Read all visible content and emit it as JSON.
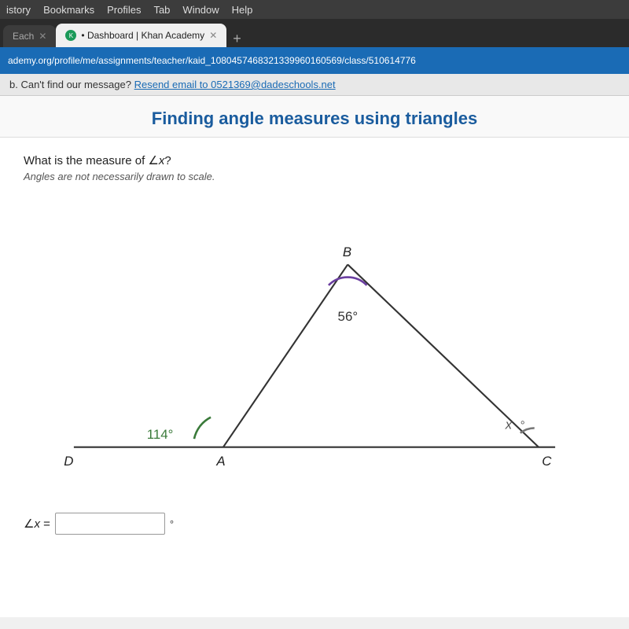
{
  "menu_bar": {
    "items": [
      "istory",
      "Bookmarks",
      "Profiles",
      "Tab",
      "Window",
      "Help"
    ]
  },
  "tabs": [
    {
      "label": "Each",
      "active": false,
      "has_favicon": false,
      "id": "tab-each"
    },
    {
      "label": "Dashboard | Khan Academy",
      "active": true,
      "has_favicon": true,
      "id": "tab-khan"
    }
  ],
  "url_bar": {
    "text": "ademy.org/profile/me/assignments/teacher/kaid_1080457468321339960160569/class/510614776"
  },
  "notification_bar": {
    "prefix_text": "b. Can't find our message?",
    "link_text": "Resend email to 0521369@dadeschools.net",
    "link_href": "mailto:0521369@dadeschools.net"
  },
  "page_title": "Finding angle measures using triangles",
  "question": {
    "main_text": "What is the measure of ∠x?",
    "note_text": "Angles are not necessarily drawn to scale."
  },
  "diagram": {
    "vertices": {
      "B": {
        "label": "B",
        "angle_label": "",
        "angle_value": "56°",
        "angle_color": "#6b3fa0"
      },
      "A": {
        "label": "A",
        "angle_label": "114°",
        "angle_color": "#3a7a3a"
      },
      "C": {
        "label": "C",
        "angle_label": "x°",
        "angle_color": "#777"
      },
      "D": {
        "label": "D"
      }
    }
  },
  "answer": {
    "label": "∠x =",
    "placeholder": "",
    "degree": "°"
  }
}
